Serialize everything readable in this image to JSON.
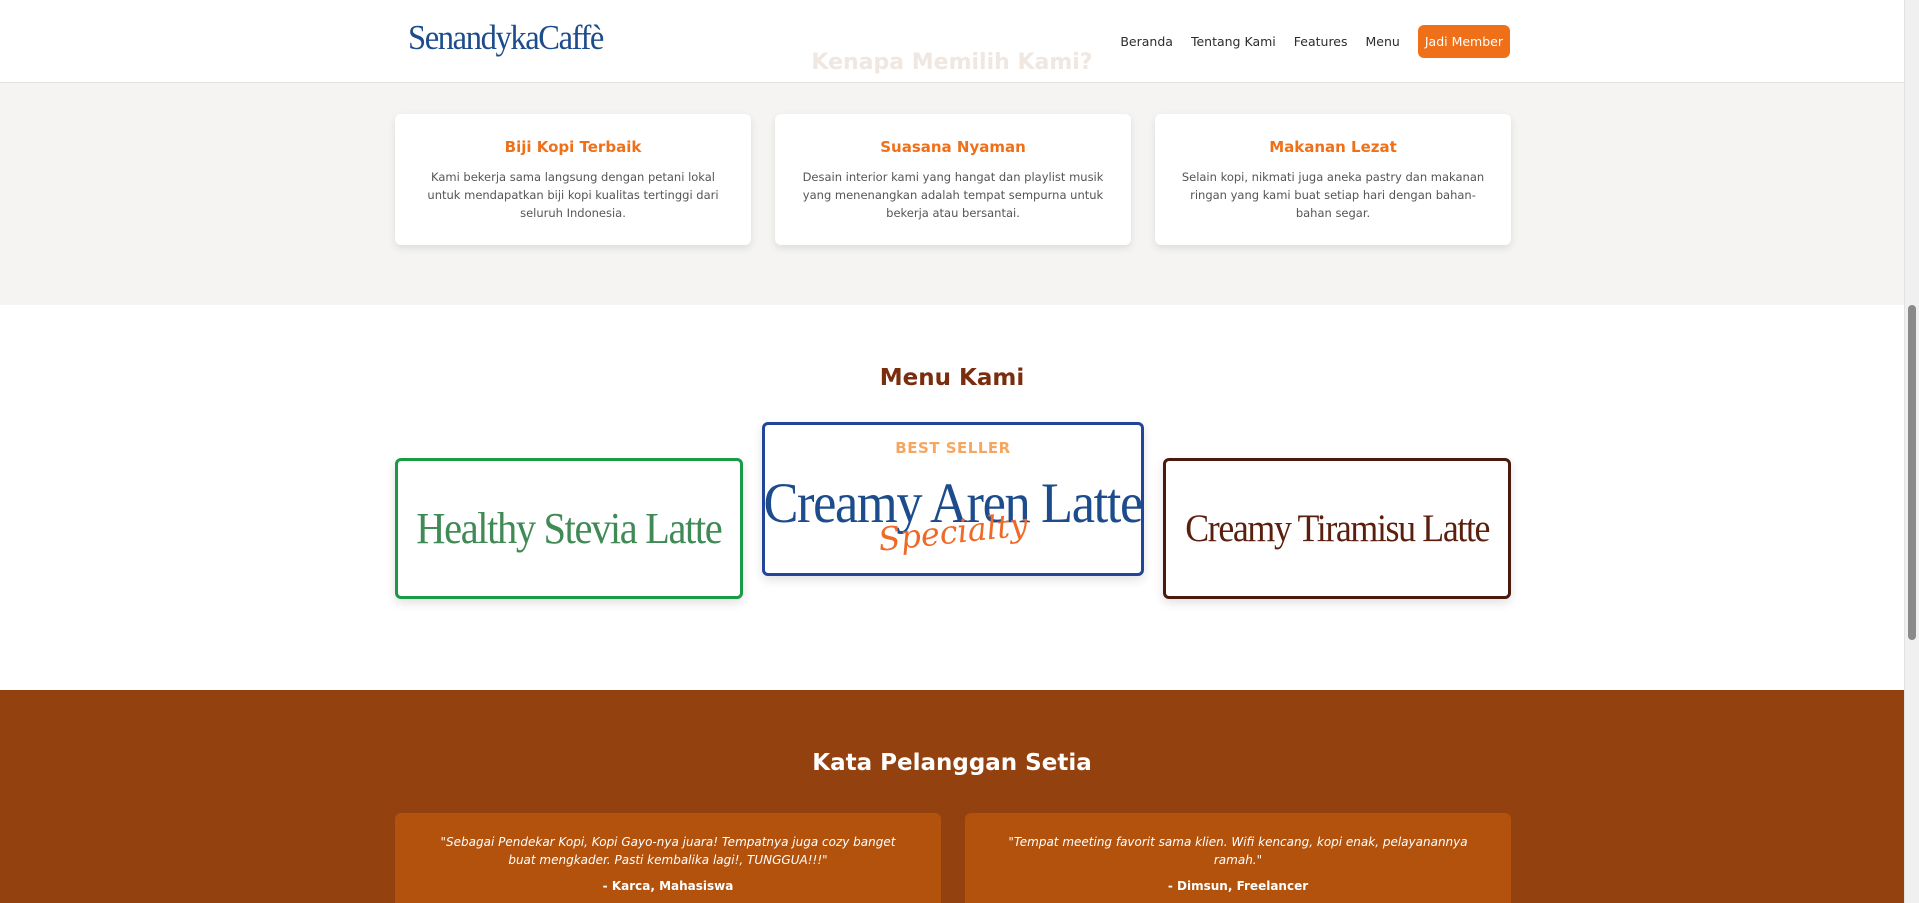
{
  "brand": {
    "logo": "SenandykaCaffè"
  },
  "nav": {
    "items": [
      {
        "label": "Beranda"
      },
      {
        "label": "Tentang Kami"
      },
      {
        "label": "Features"
      },
      {
        "label": "Menu"
      }
    ],
    "cta": "Jadi Member"
  },
  "features": {
    "heading": "Kenapa Memilih Kami?",
    "cards": [
      {
        "title": "Biji Kopi Terbaik",
        "desc": "Kami bekerja sama langsung dengan petani lokal untuk mendapatkan biji kopi kualitas tertinggi dari seluruh Indonesia."
      },
      {
        "title": "Suasana Nyaman",
        "desc": "Desain interior kami yang hangat dan playlist musik yang menenangkan adalah tempat sempurna untuk bekerja atau bersantai."
      },
      {
        "title": "Makanan Lezat",
        "desc": "Selain kopi, nikmati juga aneka pastry dan makanan ringan yang kami buat setiap hari dengan bahan-bahan segar."
      }
    ]
  },
  "menu": {
    "title": "Menu Kami",
    "items": [
      {
        "name": "Healthy Stevia Latte",
        "color": "#3f8a55",
        "border": "#1a9a47"
      },
      {
        "name": "Creamy Aren Latte",
        "badge": "BEST SELLER",
        "tag": "Specialty",
        "color": "#1d4c8c",
        "border": "#22449a"
      },
      {
        "name": "Creamy Tiramisu Latte",
        "color": "#5a1f0d",
        "border": "#4a1a0c"
      }
    ]
  },
  "testimonials": {
    "title": "Kata Pelanggan Setia",
    "items": [
      {
        "quote": "\"Sebagai Pendekar Kopi, Kopi Gayo-nya juara! Tempatnya juga cozy banget buat mengkader. Pasti kembalika lagi!, TUNGGUA!!!\"",
        "author": "- Karca, Mahasiswa"
      },
      {
        "quote": "\"Tempat meeting favorit sama klien. Wifi kencang, kopi enak, pelayanannya ramah.\"",
        "author": "- Dimsun, Freelancer"
      }
    ]
  },
  "colors": {
    "accent": "#f07019",
    "brand_blue": "#1d4c8c",
    "brown": "#93410e",
    "title_brown": "#7a2e0d"
  }
}
